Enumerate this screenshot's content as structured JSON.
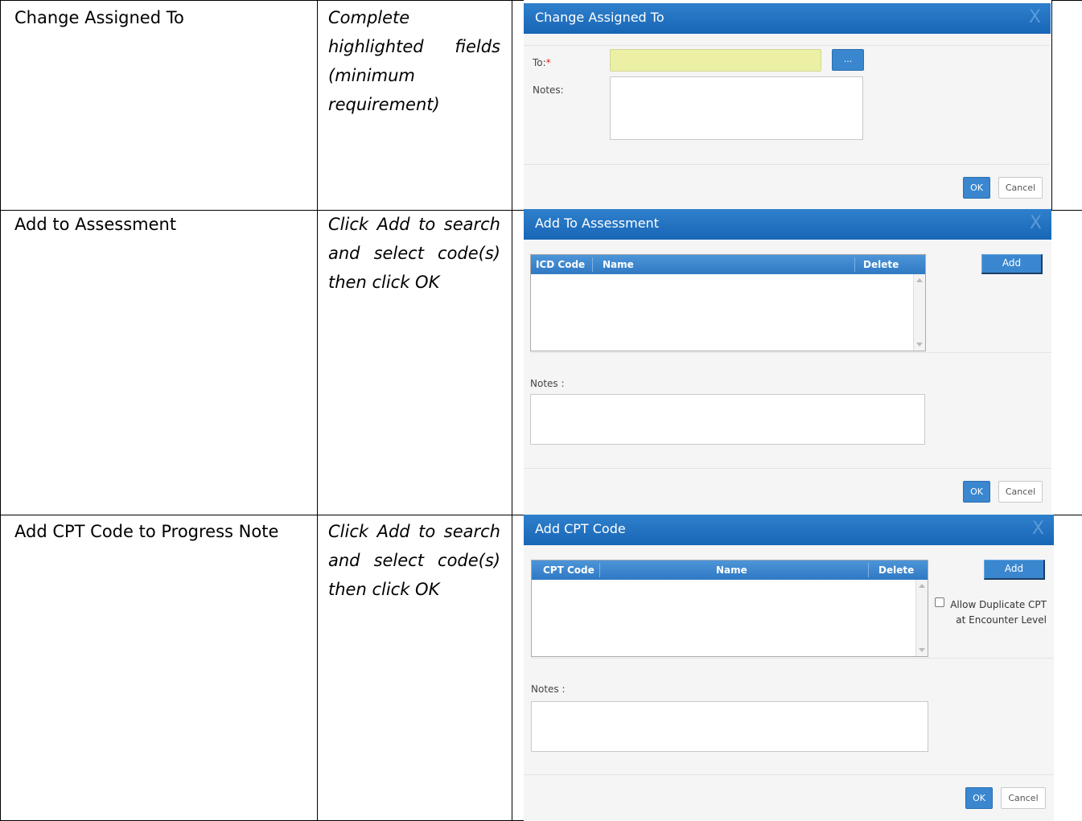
{
  "rows": [
    {
      "action": "Change Assigned To",
      "instruction": "Complete highlighted fields (minimum requirement)",
      "dialog": {
        "title": "Change Assigned To",
        "close": "X",
        "to_label": "To:",
        "required_mark": "*",
        "to_value": "",
        "browse_label": "...",
        "notes_label": "Notes:",
        "notes_value": "",
        "ok_label": "OK",
        "cancel_label": "Cancel"
      }
    },
    {
      "action": "Add to Assessment",
      "instruction": "Click Add to search and select code(s) then click OK",
      "dialog": {
        "title": "Add To Assessment",
        "close": "X",
        "columns": [
          "ICD Code",
          "Name",
          "Delete"
        ],
        "add_label": "Add",
        "notes_label": "Notes :",
        "notes_value": "",
        "ok_label": "OK",
        "cancel_label": "Cancel"
      }
    },
    {
      "action": "Add CPT Code to Progress Note",
      "instruction": "Click Add to search and select code(s) then click OK",
      "dialog": {
        "title": "Add CPT Code",
        "close": "X",
        "columns": [
          "CPT Code",
          "Name",
          "Delete"
        ],
        "add_label": "Add",
        "checkbox_label_line1": "Allow Duplicate CPT",
        "checkbox_label_line2": "at Encounter Level",
        "checkbox_checked": false,
        "notes_label": "Notes :",
        "notes_value": "",
        "ok_label": "OK",
        "cancel_label": "Cancel"
      }
    }
  ]
}
